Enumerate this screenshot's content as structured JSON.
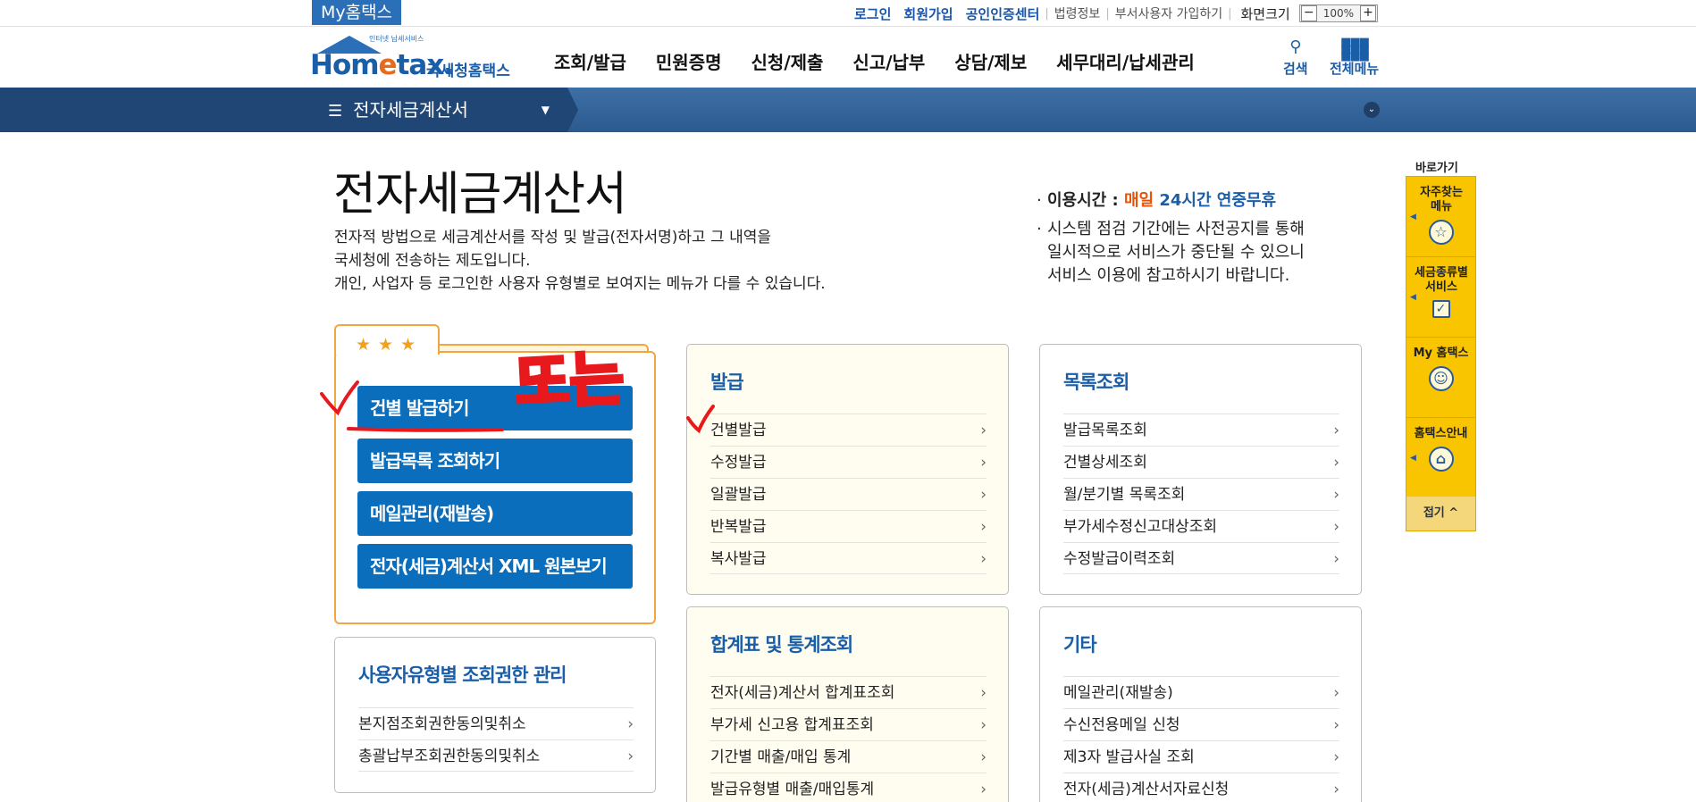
{
  "topbar": {
    "my_label": "My홈택스",
    "links_blue": [
      "로그인",
      "회원가입",
      "공인인증센터"
    ],
    "links_gray": [
      "법령정보",
      "부서사용자 가입하기"
    ],
    "zoom_label": "화면크기",
    "zoom_value": "100%",
    "zoom_minus": "−",
    "zoom_plus": "+"
  },
  "header": {
    "logo_slogan": "인터넷 납세서비스",
    "logo_mark_pre": "Hom",
    "logo_mark_e": "e",
    "logo_mark_post": "tax.",
    "logo_org": "국세청홈택스",
    "nav": [
      "조회/발급",
      "민원증명",
      "신청/제출",
      "신고/납부",
      "상담/제보",
      "세무대리/납세관리"
    ],
    "search_label": "검색",
    "allmenu_label": "전체메뉴"
  },
  "location": {
    "current": "전자세금계산서"
  },
  "page": {
    "title": "전자세금계산서",
    "desc": [
      "전자적 방법으로 세금계산서를 작성 및 발급(전자서명)하고 그 내역을",
      "국세청에 전송하는 제도입니다.",
      "개인, 사업자 등 로그인한 사용자 유형별로 보여지는 메뉴가 다를 수 있습니다."
    ],
    "notice_hours_label": "이용시간 : ",
    "notice_hours_daily": "매일",
    "notice_hours_value": " 24시간 연중무휴",
    "notice_maint": [
      "시스템 점검 기간에는 사전공지를 통해",
      "일시적으로 서비스가 중단될 수 있으니",
      "서비스 이용에 참고하시기 바랍니다."
    ]
  },
  "favorites": {
    "buttons": [
      "건별 발급하기",
      "발급목록 조회하기",
      "메일관리(재발송)",
      "전자(세금)계산서 XML 원본보기"
    ]
  },
  "panels": {
    "issue": {
      "title": "발급",
      "items": [
        "건별발급",
        "수정발급",
        "일괄발급",
        "반복발급",
        "복사발급"
      ]
    },
    "list": {
      "title": "목록조회",
      "items": [
        "발급목록조회",
        "건별상세조회",
        "월/분기별 목록조회",
        "부가세수정신고대상조회",
        "수정발급이력조회"
      ]
    },
    "auth": {
      "title": "사용자유형별 조회권한 관리",
      "items": [
        "본지점조회권한동의및취소",
        "총괄납부조회권한동의및취소"
      ]
    },
    "stats": {
      "title": "합계표 및 통계조회",
      "items": [
        "전자(세금)계산서 합계표조회",
        "부가세 신고용 합계표조회",
        "기간별 매출/매입 통계",
        "발급유형별 매출/매입통계"
      ]
    },
    "etc": {
      "title": "기타",
      "items": [
        "메일관리(재발송)",
        "수신전용메일 신청",
        "제3자 발급사실 조회",
        "전자(세금)계산서자료신청"
      ]
    }
  },
  "quickbar": {
    "title": "바로가기",
    "items": [
      {
        "label": "자주찾는 메뉴",
        "icon": "star-icon"
      },
      {
        "label": "세금종류별 서비스",
        "icon": "checkbox-icon"
      },
      {
        "label": "My 홈택스",
        "icon": "user-icon"
      },
      {
        "label": "홈택스안내",
        "icon": "guide-icon"
      }
    ],
    "close_label": "접기 ^"
  },
  "annotation": {
    "handwritten_text": "또는",
    "color": "#e8191c"
  },
  "colors": {
    "brand_blue": "#0a6ebd",
    "accent_orange": "#f2a640",
    "quick_yellow": "#f9c400"
  }
}
